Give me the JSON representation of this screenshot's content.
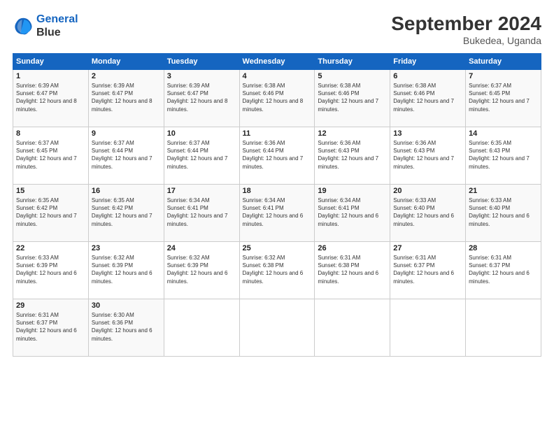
{
  "logo": {
    "line1": "General",
    "line2": "Blue"
  },
  "title": "September 2024",
  "subtitle": "Bukedea, Uganda",
  "weekdays": [
    "Sunday",
    "Monday",
    "Tuesday",
    "Wednesday",
    "Thursday",
    "Friday",
    "Saturday"
  ],
  "weeks": [
    [
      {
        "day": "1",
        "sunrise": "6:39 AM",
        "sunset": "6:47 PM",
        "daylight": "12 hours and 8 minutes."
      },
      {
        "day": "2",
        "sunrise": "6:39 AM",
        "sunset": "6:47 PM",
        "daylight": "12 hours and 8 minutes."
      },
      {
        "day": "3",
        "sunrise": "6:39 AM",
        "sunset": "6:47 PM",
        "daylight": "12 hours and 8 minutes."
      },
      {
        "day": "4",
        "sunrise": "6:38 AM",
        "sunset": "6:46 PM",
        "daylight": "12 hours and 8 minutes."
      },
      {
        "day": "5",
        "sunrise": "6:38 AM",
        "sunset": "6:46 PM",
        "daylight": "12 hours and 7 minutes."
      },
      {
        "day": "6",
        "sunrise": "6:38 AM",
        "sunset": "6:46 PM",
        "daylight": "12 hours and 7 minutes."
      },
      {
        "day": "7",
        "sunrise": "6:37 AM",
        "sunset": "6:45 PM",
        "daylight": "12 hours and 7 minutes."
      }
    ],
    [
      {
        "day": "8",
        "sunrise": "6:37 AM",
        "sunset": "6:45 PM",
        "daylight": "12 hours and 7 minutes."
      },
      {
        "day": "9",
        "sunrise": "6:37 AM",
        "sunset": "6:44 PM",
        "daylight": "12 hours and 7 minutes."
      },
      {
        "day": "10",
        "sunrise": "6:37 AM",
        "sunset": "6:44 PM",
        "daylight": "12 hours and 7 minutes."
      },
      {
        "day": "11",
        "sunrise": "6:36 AM",
        "sunset": "6:44 PM",
        "daylight": "12 hours and 7 minutes."
      },
      {
        "day": "12",
        "sunrise": "6:36 AM",
        "sunset": "6:43 PM",
        "daylight": "12 hours and 7 minutes."
      },
      {
        "day": "13",
        "sunrise": "6:36 AM",
        "sunset": "6:43 PM",
        "daylight": "12 hours and 7 minutes."
      },
      {
        "day": "14",
        "sunrise": "6:35 AM",
        "sunset": "6:43 PM",
        "daylight": "12 hours and 7 minutes."
      }
    ],
    [
      {
        "day": "15",
        "sunrise": "6:35 AM",
        "sunset": "6:42 PM",
        "daylight": "12 hours and 7 minutes."
      },
      {
        "day": "16",
        "sunrise": "6:35 AM",
        "sunset": "6:42 PM",
        "daylight": "12 hours and 7 minutes."
      },
      {
        "day": "17",
        "sunrise": "6:34 AM",
        "sunset": "6:41 PM",
        "daylight": "12 hours and 7 minutes."
      },
      {
        "day": "18",
        "sunrise": "6:34 AM",
        "sunset": "6:41 PM",
        "daylight": "12 hours and 6 minutes."
      },
      {
        "day": "19",
        "sunrise": "6:34 AM",
        "sunset": "6:41 PM",
        "daylight": "12 hours and 6 minutes."
      },
      {
        "day": "20",
        "sunrise": "6:33 AM",
        "sunset": "6:40 PM",
        "daylight": "12 hours and 6 minutes."
      },
      {
        "day": "21",
        "sunrise": "6:33 AM",
        "sunset": "6:40 PM",
        "daylight": "12 hours and 6 minutes."
      }
    ],
    [
      {
        "day": "22",
        "sunrise": "6:33 AM",
        "sunset": "6:39 PM",
        "daylight": "12 hours and 6 minutes."
      },
      {
        "day": "23",
        "sunrise": "6:32 AM",
        "sunset": "6:39 PM",
        "daylight": "12 hours and 6 minutes."
      },
      {
        "day": "24",
        "sunrise": "6:32 AM",
        "sunset": "6:39 PM",
        "daylight": "12 hours and 6 minutes."
      },
      {
        "day": "25",
        "sunrise": "6:32 AM",
        "sunset": "6:38 PM",
        "daylight": "12 hours and 6 minutes."
      },
      {
        "day": "26",
        "sunrise": "6:31 AM",
        "sunset": "6:38 PM",
        "daylight": "12 hours and 6 minutes."
      },
      {
        "day": "27",
        "sunrise": "6:31 AM",
        "sunset": "6:37 PM",
        "daylight": "12 hours and 6 minutes."
      },
      {
        "day": "28",
        "sunrise": "6:31 AM",
        "sunset": "6:37 PM",
        "daylight": "12 hours and 6 minutes."
      }
    ],
    [
      {
        "day": "29",
        "sunrise": "6:31 AM",
        "sunset": "6:37 PM",
        "daylight": "12 hours and 6 minutes."
      },
      {
        "day": "30",
        "sunrise": "6:30 AM",
        "sunset": "6:36 PM",
        "daylight": "12 hours and 6 minutes."
      },
      null,
      null,
      null,
      null,
      null
    ]
  ]
}
